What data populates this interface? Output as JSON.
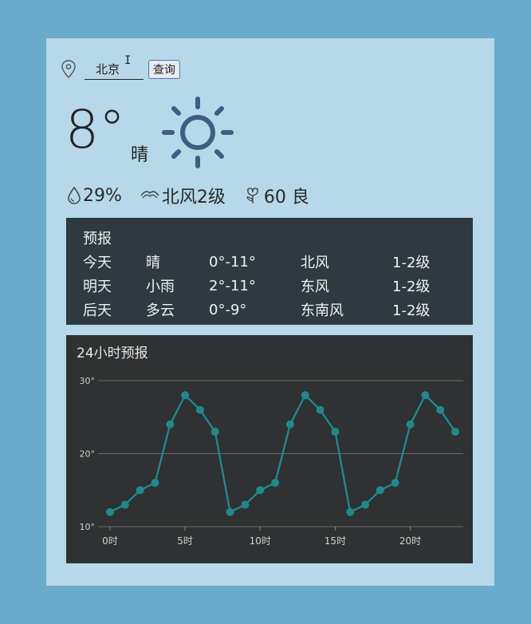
{
  "search": {
    "city_value": "北京",
    "button_label": "查询"
  },
  "current": {
    "temperature": "8°",
    "condition": "晴",
    "humidity": "29%",
    "wind": "北风2级",
    "aqi": "60 良",
    "weather_icon": "sun-icon"
  },
  "forecast": {
    "title": "预报",
    "rows": [
      {
        "day": "今天",
        "condition": "晴",
        "temp": "0°-11°",
        "wind": "北风",
        "level": "1-2级"
      },
      {
        "day": "明天",
        "condition": "小雨",
        "temp": "2°-11°",
        "wind": "东风",
        "level": "1-2级"
      },
      {
        "day": "后天",
        "condition": "多云",
        "temp": "0°-9°",
        "wind": "东南风",
        "level": "1-2级"
      }
    ]
  },
  "hourly": {
    "title": "24小时预报"
  },
  "chart_data": {
    "type": "line",
    "x": [
      0,
      1,
      2,
      3,
      4,
      5,
      6,
      7,
      8,
      9,
      10,
      11,
      12,
      13,
      14,
      15,
      16,
      17,
      18,
      19,
      20,
      21,
      22,
      23
    ],
    "series": [
      {
        "values": [
          12,
          13,
          15,
          16,
          24,
          28,
          26,
          23,
          12,
          13,
          15,
          16,
          24,
          28,
          26,
          23,
          12,
          13,
          15,
          16,
          24,
          28,
          26,
          23
        ]
      }
    ],
    "x_ticks": [
      0,
      5,
      10,
      15,
      20
    ],
    "x_tick_labels": [
      "0时",
      "5时",
      "10时",
      "15时",
      "20时"
    ],
    "y_ticks": [
      10,
      20,
      30
    ],
    "y_tick_labels": [
      "10°",
      "20°",
      "30°"
    ],
    "ylim": [
      10,
      30
    ],
    "grid": true,
    "line_color": "#1e8a8c"
  }
}
